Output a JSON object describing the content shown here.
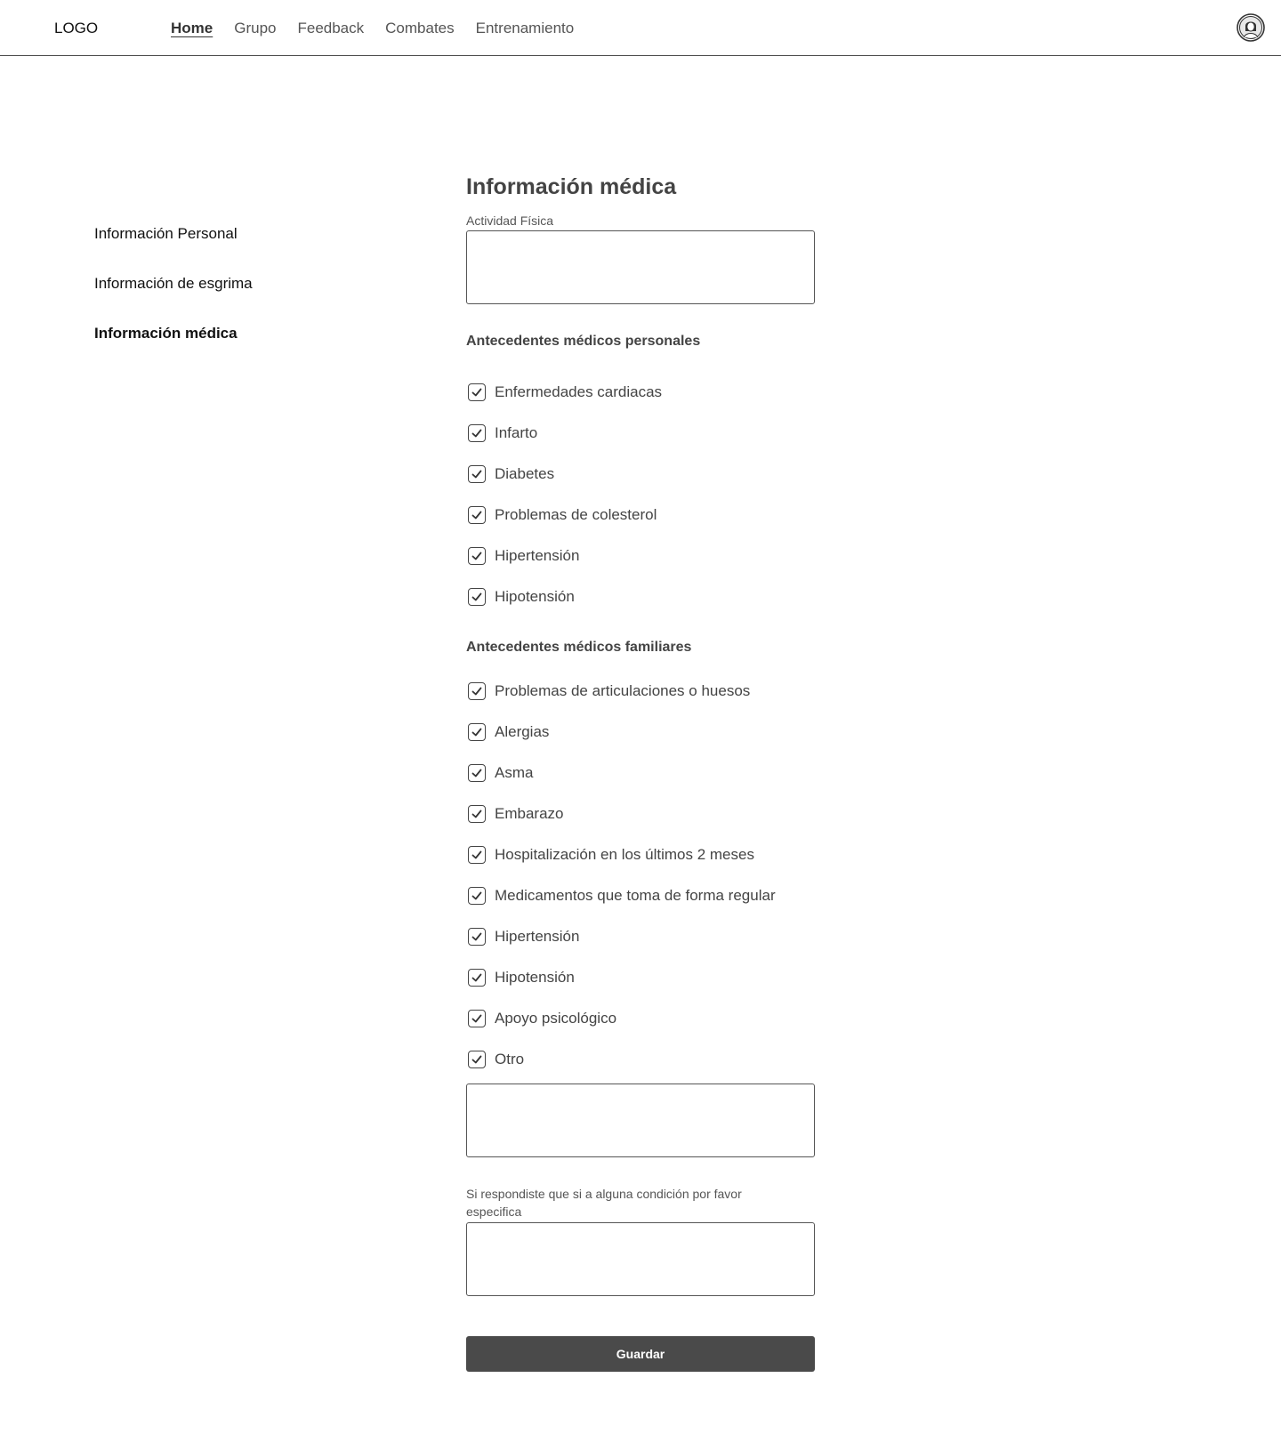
{
  "header": {
    "logo": "LOGO",
    "nav": [
      {
        "label": "Home",
        "active": true
      },
      {
        "label": "Grupo",
        "active": false
      },
      {
        "label": "Feedback",
        "active": false
      },
      {
        "label": "Combates",
        "active": false
      },
      {
        "label": "Entrenamiento",
        "active": false
      }
    ],
    "avatar_icon": "user-avatar-icon"
  },
  "sidebar": {
    "items": [
      {
        "label": "Información Personal",
        "active": false
      },
      {
        "label": "Información de esgrima",
        "active": false
      },
      {
        "label": "Información médica",
        "active": true
      }
    ]
  },
  "form": {
    "title": "Información médica",
    "physical_activity_label": "Actividad Física",
    "physical_activity_value": "",
    "personal_history_heading": "Antecedentes médicos personales",
    "personal_history": [
      {
        "label": "Enfermedades cardiacas",
        "checked": true
      },
      {
        "label": "Infarto",
        "checked": true
      },
      {
        "label": "Diabetes",
        "checked": true
      },
      {
        "label": "Problemas de colesterol",
        "checked": true
      },
      {
        "label": "Hipertensión",
        "checked": true
      },
      {
        "label": "Hipotensión",
        "checked": true
      }
    ],
    "family_history_heading": "Antecedentes médicos familiares",
    "family_history": [
      {
        "label": "Problemas de articulaciones o huesos",
        "checked": true
      },
      {
        "label": "Alergias",
        "checked": true
      },
      {
        "label": "Asma",
        "checked": true
      },
      {
        "label": "Embarazo",
        "checked": true
      },
      {
        "label": "Hospitalización en los últimos 2 meses",
        "checked": true
      },
      {
        "label": "Medicamentos que toma de forma regular",
        "checked": true
      },
      {
        "label": "Hipertensión",
        "checked": true
      },
      {
        "label": "Hipotensión",
        "checked": true
      },
      {
        "label": "Apoyo psicológico",
        "checked": true
      },
      {
        "label": "Otro",
        "checked": true
      }
    ],
    "other_value": "",
    "specify_label": "Si respondiste que si a alguna condición por favor especifica",
    "specify_value": "",
    "save_label": "Guardar"
  },
  "colors": {
    "primary_button": "#4a4a4a",
    "text": "#4a4a4a"
  }
}
